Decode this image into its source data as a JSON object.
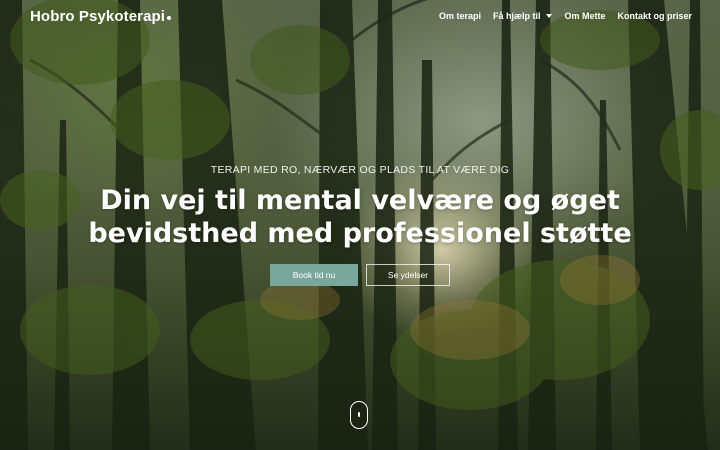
{
  "header": {
    "logo_text": "Hobro Psykoterapi",
    "nav": [
      {
        "label": "Om terapi"
      },
      {
        "label": "Få hjælp til"
      },
      {
        "label": "Om Mette"
      },
      {
        "label": "Kontakt og priser"
      }
    ]
  },
  "hero": {
    "kicker": "TERAPI MED RO, NÆRVÆR OG PLADS TIL AT VÆRE DIG",
    "headline": "Din vej til mental velvære og øget bevidsthed med professionel støtte",
    "primary_button": "Book tid nu",
    "secondary_button": "Se ydelser"
  },
  "colors": {
    "primary_button": "#7aa79b",
    "text": "#ffffff"
  }
}
